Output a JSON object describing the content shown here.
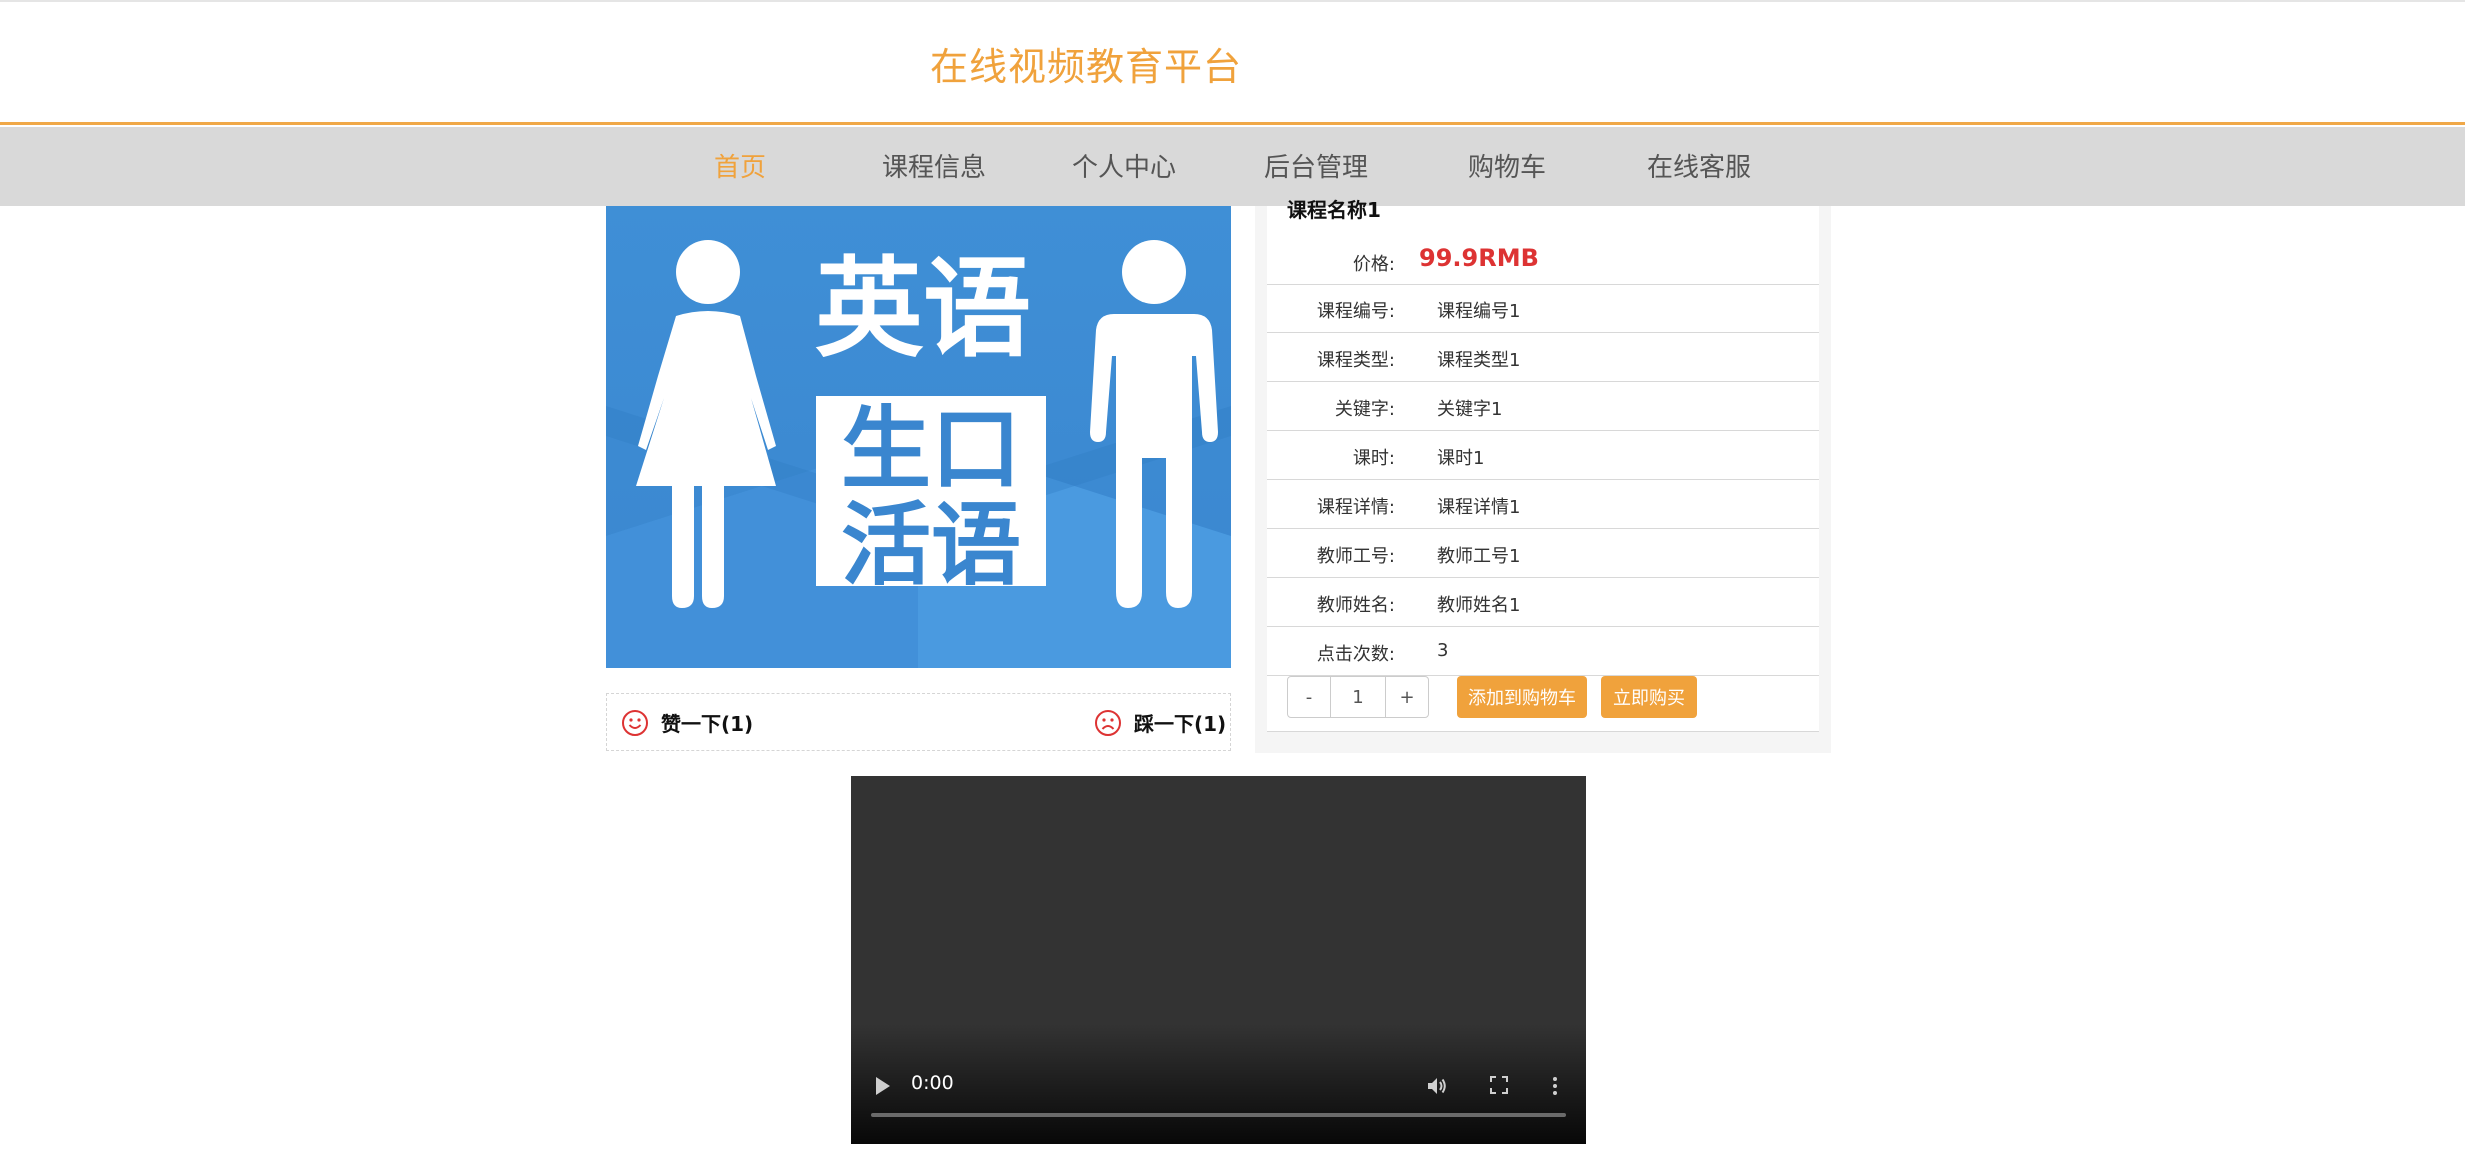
{
  "header": {
    "site_title": "在线视频教育平台"
  },
  "nav": {
    "items": [
      {
        "label": "首页",
        "active": true
      },
      {
        "label": "课程信息"
      },
      {
        "label": "个人中心"
      },
      {
        "label": "后台管理"
      },
      {
        "label": "购物车"
      },
      {
        "label": "在线客服"
      }
    ]
  },
  "course_image": {
    "title_top": "英语",
    "title_mid": "生口",
    "title_bot": "活语"
  },
  "votes": {
    "like_label": "赞一下(1)",
    "dislike_label": "踩一下(1)"
  },
  "course": {
    "name": "课程名称1",
    "price_label": "价格:",
    "price_value": "99.9RMB",
    "fields": [
      {
        "label": "课程编号:",
        "value": "课程编号1"
      },
      {
        "label": "课程类型:",
        "value": "课程类型1"
      },
      {
        "label": "关键字:",
        "value": "关键字1"
      },
      {
        "label": "课时:",
        "value": "课时1"
      },
      {
        "label": "课程详情:",
        "value": "课程详情1"
      },
      {
        "label": "教师工号:",
        "value": "教师工号1"
      },
      {
        "label": "教师姓名:",
        "value": "教师姓名1"
      },
      {
        "label": "点击次数:",
        "value": "3"
      }
    ]
  },
  "purchase": {
    "minus": "-",
    "quantity": "1",
    "plus": "+",
    "add_to_cart": "添加到购物车",
    "buy_now": "立即购买"
  },
  "video": {
    "time": "0:00"
  },
  "colors": {
    "accent": "#f0a23c",
    "price": "#dd3333",
    "nav_bg": "#d9d9d9"
  }
}
